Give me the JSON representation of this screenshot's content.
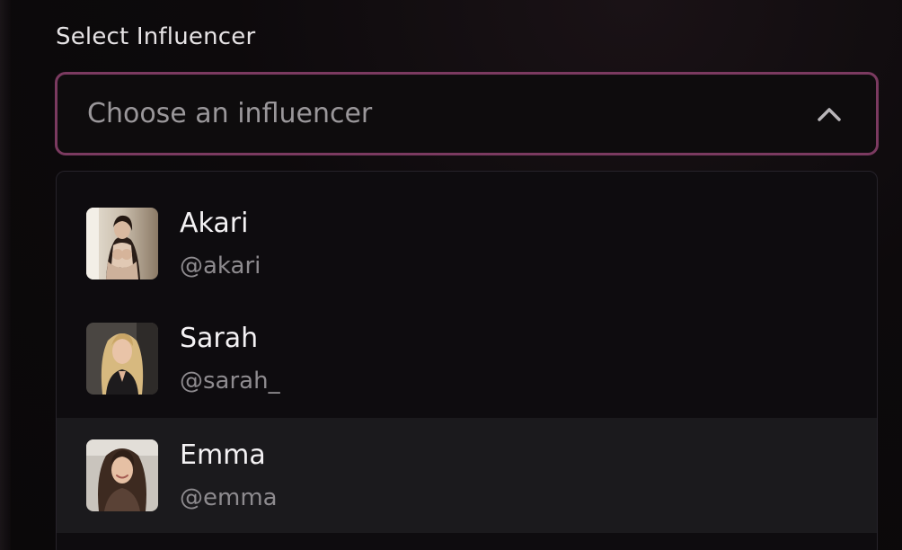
{
  "field": {
    "label": "Select Influencer",
    "placeholder": "Choose an influencer",
    "state": "open",
    "border_color": "#7b3a60"
  },
  "options": [
    {
      "name": "Akari",
      "handle": "@akari",
      "avatar_icon": "avatar-photo-akari",
      "highlighted": false
    },
    {
      "name": "Sarah",
      "handle": "@sarah_",
      "avatar_icon": "avatar-photo-sarah",
      "highlighted": false
    },
    {
      "name": "Emma",
      "handle": "@emma",
      "avatar_icon": "avatar-photo-emma",
      "highlighted": true
    }
  ],
  "colors": {
    "background": "#0c090b",
    "dropdown_bg": "#0e0c0f",
    "highlight_bg": "#1b1a1d",
    "name_text": "#f4f2f4",
    "handle_text": "#8e8b8f"
  }
}
